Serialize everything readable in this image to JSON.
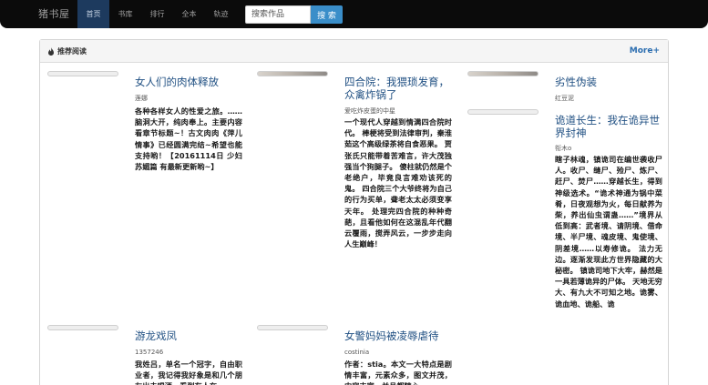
{
  "nav": {
    "brand": "猪书屋",
    "items": [
      {
        "label": "首页",
        "active": true
      },
      {
        "label": "书库",
        "active": false
      },
      {
        "label": "排行",
        "active": false
      },
      {
        "label": "全本",
        "active": false
      },
      {
        "label": "轨迹",
        "active": false
      }
    ],
    "search_placeholder": "搜索作品",
    "search_button": "搜 索"
  },
  "panel": {
    "title": "推荐阅读",
    "more": "More+"
  },
  "books": [
    {
      "title": "女人们的肉体释放",
      "author": "莲娜",
      "desc": "各种各样女人的性爱之旅。……脑洞大开，纯肉奉上。主要内容看章节标题~！古文肉肉《萍儿情事》已经圆满完结~希望也能支持哟！【20161114日 少妇苏媚篇 有最新更新哟~】"
    },
    {
      "title": "四合院：我猥琐发育，众禽炸锅了",
      "author": "爱吃炸皮蛋的中星",
      "desc": "一个现代人穿越到情满四合院时代。 棒梗将受到法律审判，秦淮茹这个高级绿茶将自食恶果。 贾张氏只能带着苦难言，许大茂独强当个狗腿子。 傻柱就仍然是个老绝户，毕竟良言难劝该死的鬼。 四合院三个大爷终将为自己的行为买单，聋老太太必须变享天年。 处理完四合院的种种奇葩，且看他如何在这混乱年代翻云覆雨，搅弄风云，一步步走向人生巅峰！"
    },
    {
      "title": "劣性伪装",
      "author": "红豆泥",
      "desc": ""
    },
    {
      "title": "诡道长生：我在诡异世界封神",
      "author": "衔木o",
      "desc": "瞎子林魂，镇诡司在编世袭收尸人。收尸、缝尸、殓尸、炼尸、赶尸、焚尸……穿越长生，得到神级选术。“诡术神通为锅中菜肴，日夜观想为火，每日献养为柴，养出仙虫谓蛊……”境界从低到高：武者境、请阴境、借命境、半尸境、魂皮境、鬼使境、阴差境……以寿修诡。 法力无边。逐渐发现此方世界隐藏的大秘密。 镇诡司地下大牢，赫然是一具若薄诡异的尸体。 天地无穷大、有九大不可知之地。诡雾、诡血地、诡船、诡"
    },
    {
      "title": "游龙戏凤",
      "author": "1357246",
      "desc": "我姓吕，单名一个冠字，自由职业者，我记得我好象是和几个朋友出去喝酒，看到有人在"
    },
    {
      "title": "女警妈妈被凌辱虐待",
      "author": "costinia",
      "desc": "作者：stia。本文一大特点是剧情丰富，元素众多，图文并茂，内容丰富，并且都精心"
    }
  ]
}
